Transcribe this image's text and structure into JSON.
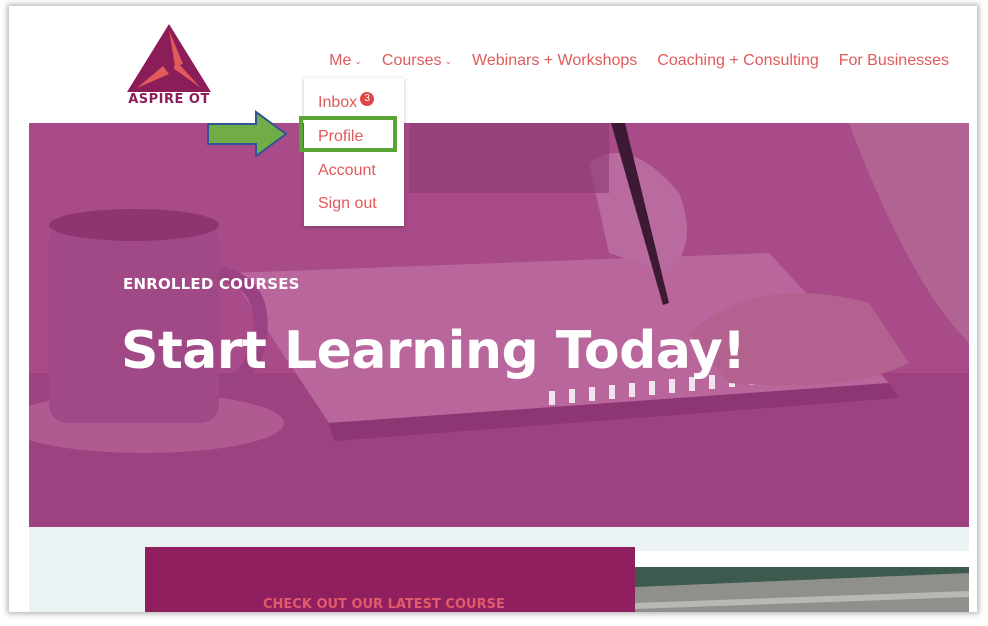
{
  "brand": {
    "name": "ASPIRE OT",
    "color": "#8b1d58"
  },
  "nav": {
    "me_label": "Me",
    "courses_label": "Courses",
    "webinars_label": "Webinars + Workshops",
    "coaching_label": "Coaching + Consulting",
    "business_label": "For Businesses",
    "caret_icon": "chevron-down-icon"
  },
  "dropdown": {
    "inbox_label": "Inbox",
    "inbox_badge": "3",
    "profile_label": "Profile",
    "account_label": "Account",
    "signout_label": "Sign out"
  },
  "hero": {
    "subtitle": "ENROLLED COURSES",
    "title": "Start Learning Today!"
  },
  "lower": {
    "card_text": "CHECK OUT OUR LATEST COURSE"
  },
  "colors": {
    "accent": "#e05a5a",
    "hero_overlay": "#a84b88",
    "card": "#8f1f5e",
    "highlight": "#5aa335"
  }
}
